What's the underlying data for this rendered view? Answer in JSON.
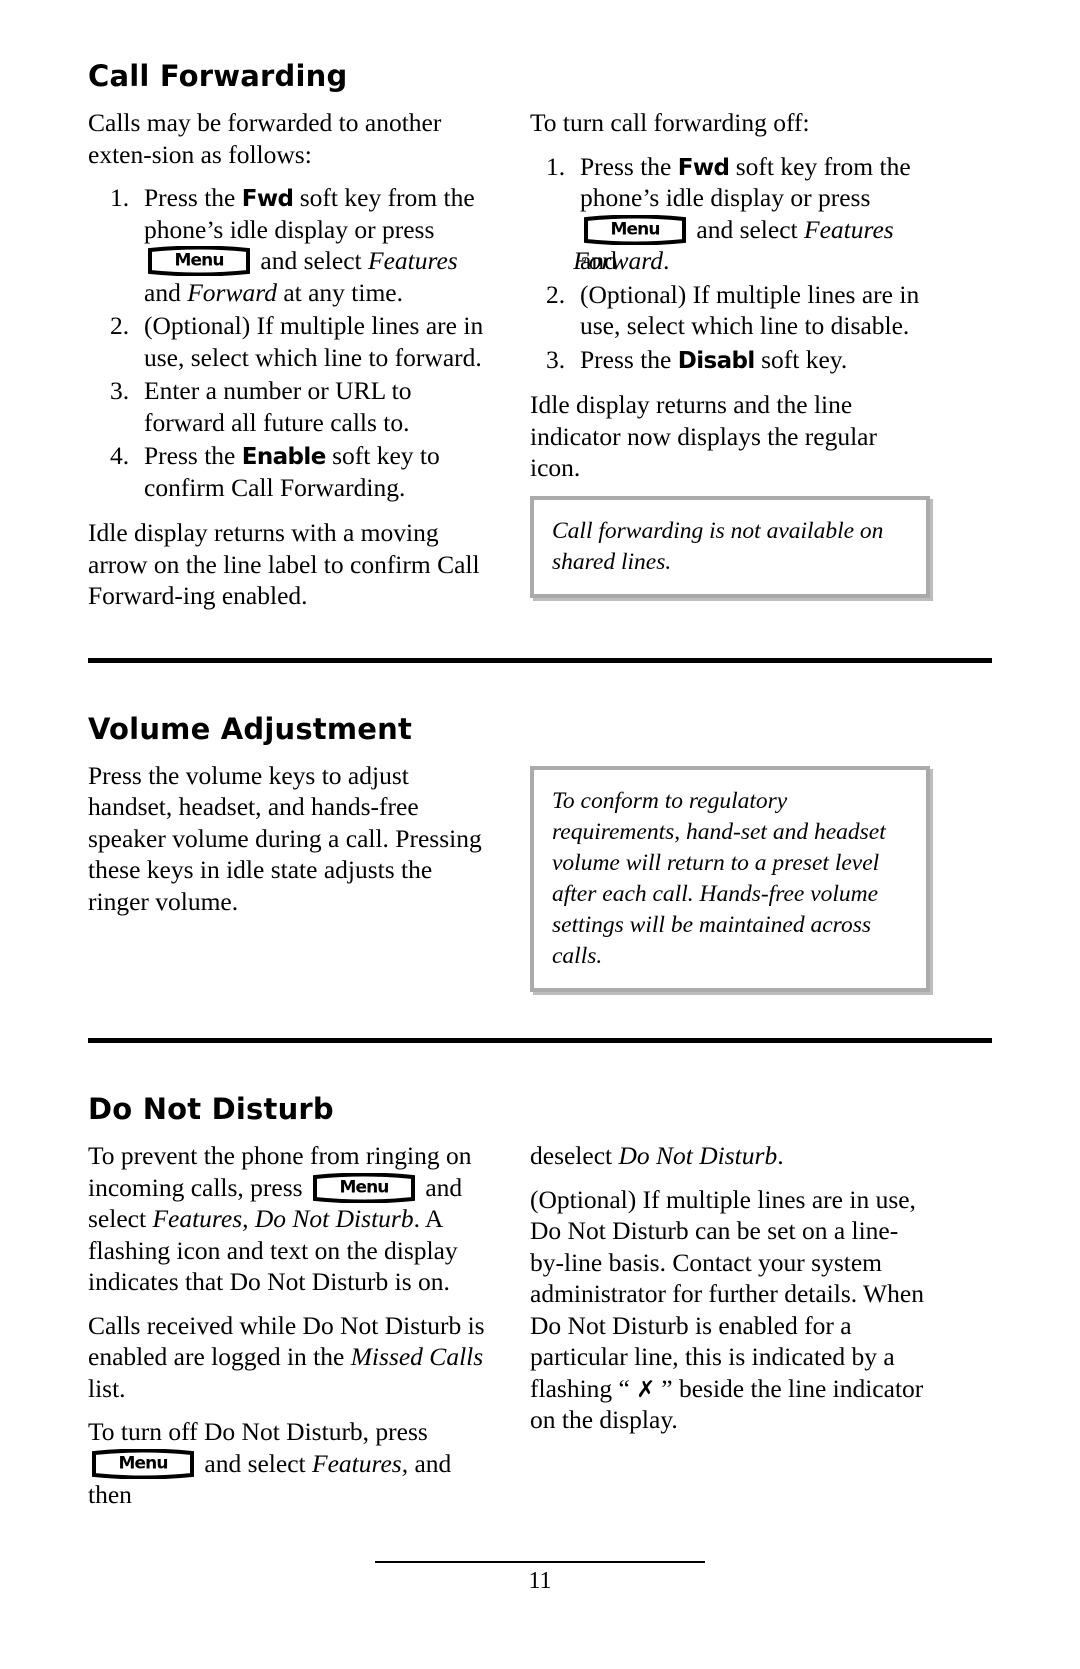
{
  "document": {
    "page_number": "11"
  },
  "sections": [
    {
      "id": "call-forwarding",
      "heading": "Call Forwarding",
      "left": {
        "intro": "Calls may be forwarded to another exten-sion as follows:",
        "steps": [
          {
            "a": "Press the ",
            "key": "Fwd",
            "b": " soft key from the phone’s idle display or press ",
            "menu": "Menu",
            "c": " and select ",
            "ital1": "Features",
            "d": " and ",
            "ital2": "Forward",
            "e": " at any time."
          },
          {
            "a": "(Optional) If multiple lines are in use, select which line to forward."
          },
          {
            "a": "Enter a number or URL to forward all future calls to."
          },
          {
            "a": "Press the ",
            "key": "Enable",
            "b": " soft key to confirm Call Forwarding."
          }
        ],
        "outro": "Idle display returns with a moving arrow on the line label to confirm Call Forward-ing enabled."
      },
      "right": {
        "intro": "To turn call forwarding off:",
        "steps": [
          {
            "a": "Press the ",
            "key": "Fwd",
            "b": " soft key from the phone’s idle display or press ",
            "menu": "Menu",
            "c": " and select ",
            "ital1": "Features",
            "d": " and ",
            "ital2": "Forward",
            "e": "."
          },
          {
            "a": "(Optional) If multiple lines are in use, select which line to disable."
          },
          {
            "a": "Press the ",
            "key": "Disabl",
            "b": " soft key."
          }
        ],
        "outro": "Idle display returns and the line indicator now displays the regular icon.",
        "note": "Call forwarding is not available on shared lines."
      }
    },
    {
      "id": "volume-adjustment",
      "heading": "Volume Adjustment",
      "left": {
        "body": "Press the volume keys to adjust handset, headset, and hands-free speaker volume during a call.  Pressing these keys in idle state adjusts the ringer volume."
      },
      "right": {
        "note": "To conform to regulatory requirements, hand-set and headset volume will return to a preset level after each call.  Hands-free volume settings will be maintained across calls."
      }
    },
    {
      "id": "do-not-disturb",
      "heading": "Do Not Disturb",
      "left": {
        "p1": {
          "a": "To prevent the phone from ringing on incoming calls, press ",
          "menu": "Menu",
          "b": " and select ",
          "ital1": "Features, Do Not Disturb",
          "c": ".  A flashing icon and text on the display indicates that Do Not Disturb is on."
        },
        "p2": {
          "a": "Calls received while Do Not Disturb is enabled are logged in the ",
          "ital1": "Missed Calls",
          "b": " list."
        },
        "p3": {
          "a": "To turn off Do Not Disturb, press ",
          "menu": "Menu",
          "b": " and select ",
          "ital1": "Features,",
          "c": " and then"
        }
      },
      "right": {
        "p1": {
          "a": "deselect ",
          "ital1": "Do Not Disturb",
          "b": "."
        },
        "p2": {
          "a": "(Optional) If multiple lines are in use, Do Not Disturb can be set on a line-by-line basis.  Contact your system administrator for further details.  When Do Not Disturb is enabled for a particular line, this is indicated by a flashing “ ",
          "glyph": "✗",
          "b": " ” beside the line indicator on the display."
        }
      }
    }
  ]
}
